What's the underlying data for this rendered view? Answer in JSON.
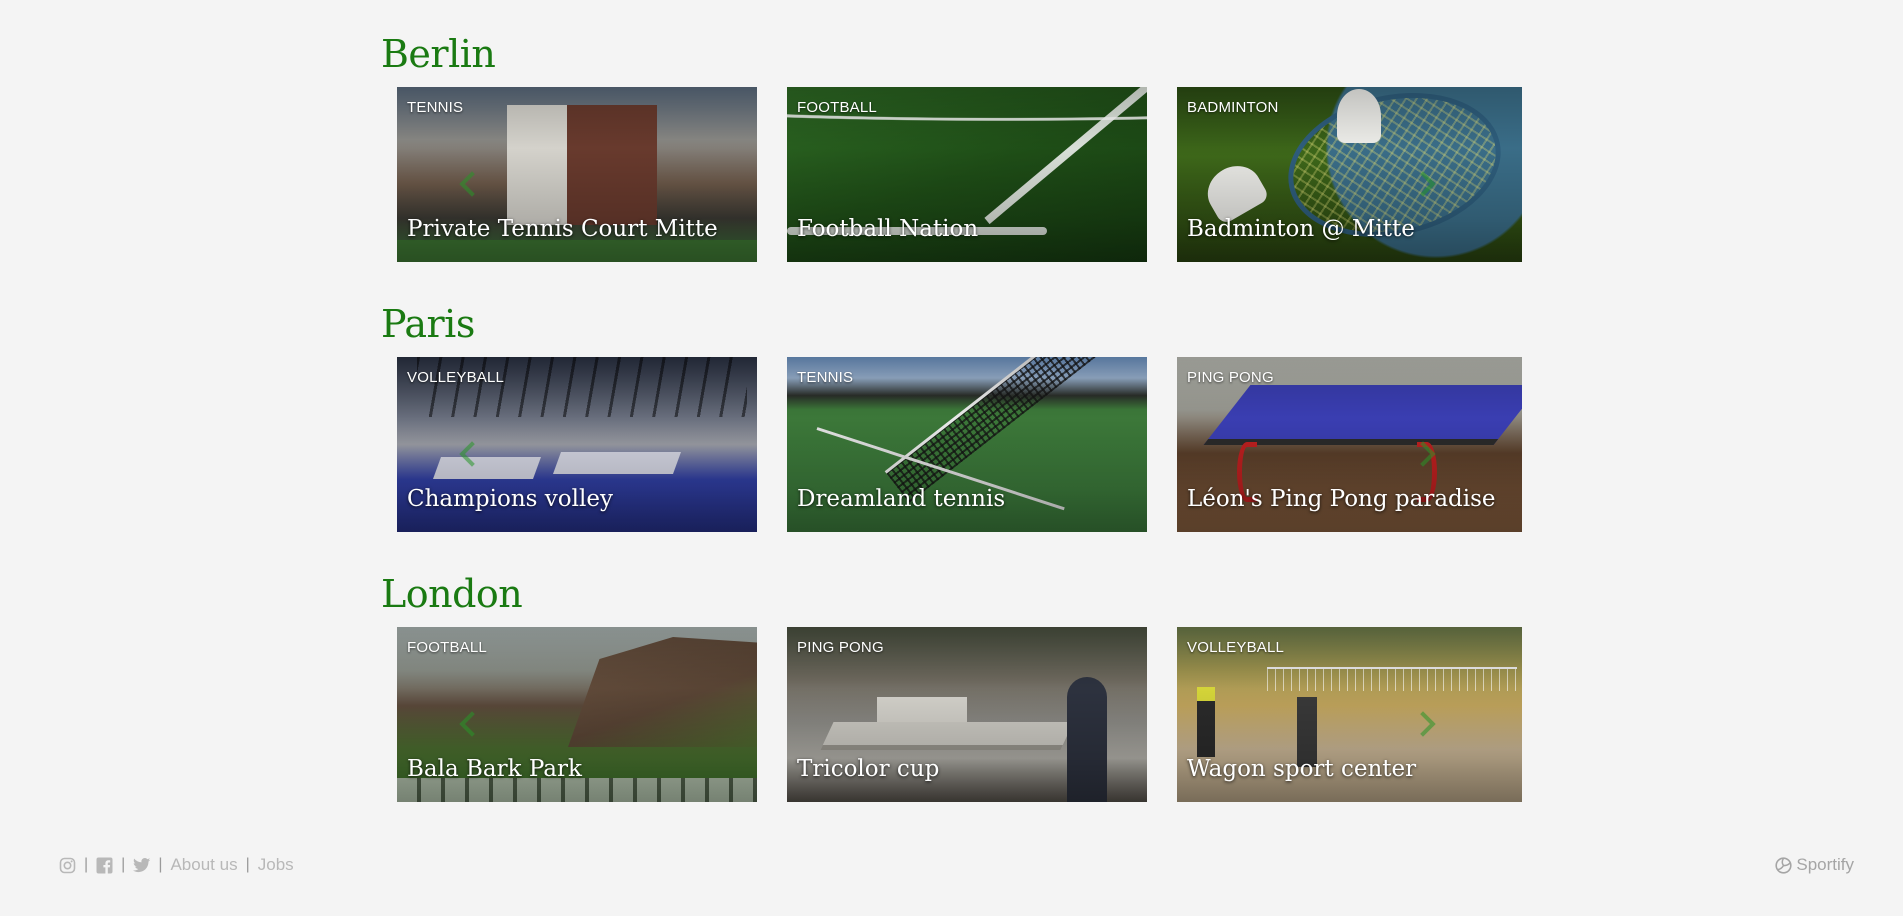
{
  "cities": [
    {
      "name": "Berlin",
      "venues": [
        {
          "sport": "TENNIS",
          "name": "Private Tennis Court Mitte"
        },
        {
          "sport": "FOOTBALL",
          "name": "Football Nation"
        },
        {
          "sport": "BADMINTON",
          "name": "Badminton @ Mitte"
        }
      ]
    },
    {
      "name": "Paris",
      "venues": [
        {
          "sport": "VOLLEYBALL",
          "name": "Champions volley"
        },
        {
          "sport": "TENNIS",
          "name": "Dreamland tennis"
        },
        {
          "sport": "PING PONG",
          "name": "Léon's Ping Pong paradise"
        }
      ]
    },
    {
      "name": "London",
      "venues": [
        {
          "sport": "FOOTBALL",
          "name": "Bala Bark Park"
        },
        {
          "sport": "PING PONG",
          "name": "Tricolor cup"
        },
        {
          "sport": "VOLLEYBALL",
          "name": "Wagon sport center"
        }
      ]
    }
  ],
  "footer": {
    "icons": [
      "instagram-icon",
      "facebook-icon",
      "twitter-icon"
    ],
    "separator": "|",
    "about_label": "About us",
    "jobs_label": "Jobs",
    "brand": "Sportify",
    "brand_icon": "volleyball-icon"
  },
  "colors": {
    "accent": "#1a7a12",
    "background": "#f4f4f4",
    "footer_text": "#b8b8b8"
  }
}
